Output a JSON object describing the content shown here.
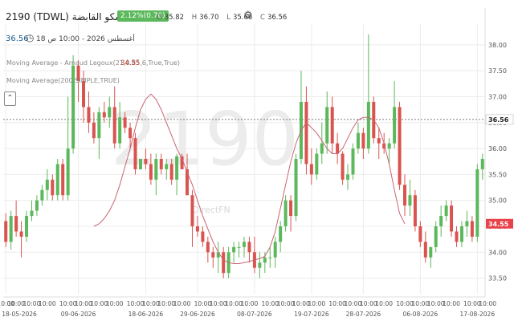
{
  "header": {
    "title": "2190  (TDWL)  سيسكو القابضة",
    "change_badge": "2.12%(0.76)",
    "ohlc": [
      {
        "label": "O",
        "value": "35.82"
      },
      {
        "label": "H",
        "value": "36.70"
      },
      {
        "label": "L",
        "value": "35.66"
      },
      {
        "label": "C",
        "value": "36.56"
      }
    ],
    "last_price": "36.56",
    "timestamp": "18 أغسطس 2026 - 10:00 ص",
    "icons": {
      "settings": "gear-icon",
      "clock": "clock-icon",
      "collapse": "chevron-up-icon"
    }
  },
  "indicators": [
    {
      "label": "Moving Average - Arnaud Legoux(21,0.85,6,True,True)",
      "value": "34.55"
    },
    {
      "label": "Moving Average(200,SIMPLE,TRUE)",
      "value": ""
    }
  ],
  "watermark": {
    "symbol": "2190",
    "brand": "DirectFN"
  },
  "colors": {
    "up": "#5cb85c",
    "down": "#d9534f",
    "ma": "#c86472",
    "grid": "#ececec",
    "last_price_label": "#222222",
    "ma_label": "#e8424a"
  },
  "chart_data": {
    "type": "candlestick",
    "ylim": [
      33.2,
      38.4
    ],
    "yticks": [
      33.5,
      34.0,
      34.5,
      35.0,
      35.5,
      36.0,
      36.5,
      37.0,
      37.5,
      38.0
    ],
    "ytick_labels": [
      "33.50",
      "34.00",
      "34.50",
      "35.00",
      "35.50",
      "36.00",
      "36.50",
      "37.00",
      "37.50",
      "38.00"
    ],
    "price_labels": [
      {
        "value": 36.56,
        "label": "36.56",
        "style": "last"
      },
      {
        "value": 34.55,
        "label": "34.55",
        "style": "ma"
      }
    ],
    "xtick_labels": [
      {
        "index": 0,
        "label": "10:00"
      },
      {
        "index": 2,
        "label": "10:00"
      },
      {
        "index": 5,
        "label": "10:00"
      },
      {
        "index": 8,
        "label": "10:00"
      },
      {
        "index": 12,
        "label": "10:00"
      },
      {
        "index": 15,
        "label": "10:00"
      },
      {
        "index": 18,
        "label": "10:00"
      },
      {
        "index": 21,
        "label": "10:00"
      },
      {
        "index": 25,
        "label": "10:00"
      },
      {
        "index": 28,
        "label": "10:00"
      },
      {
        "index": 31,
        "label": "10:00"
      },
      {
        "index": 34,
        "label": "10:00"
      },
      {
        "index": 38,
        "label": "10:00"
      },
      {
        "index": 41,
        "label": "10:00"
      },
      {
        "index": 44,
        "label": "10:00"
      },
      {
        "index": 47,
        "label": "10:00"
      },
      {
        "index": 51,
        "label": "10:00"
      },
      {
        "index": 54,
        "label": "10:00"
      },
      {
        "index": 57,
        "label": "10:00"
      },
      {
        "index": 60,
        "label": "10:00"
      },
      {
        "index": 64,
        "label": "10:00"
      },
      {
        "index": 67,
        "label": "10:00"
      },
      {
        "index": 70,
        "label": "10:00"
      },
      {
        "index": 73,
        "label": "10:00"
      },
      {
        "index": 77,
        "label": "10:00"
      },
      {
        "index": 80,
        "label": "10:00"
      },
      {
        "index": 83,
        "label": "10:00"
      },
      {
        "index": 86,
        "label": "10:00"
      },
      {
        "index": 90,
        "label": "10:00"
      },
      {
        "index": 93,
        "label": "10:00"
      }
    ],
    "date_labels": [
      {
        "index": 0,
        "label": "18-05-2026"
      },
      {
        "index": 14,
        "label": "09-06-2026"
      },
      {
        "index": 27,
        "label": "18-06-2026"
      },
      {
        "index": 37,
        "label": "29-06-2026"
      },
      {
        "index": 48,
        "label": "08-07-2026"
      },
      {
        "index": 59,
        "label": "19-07-2026"
      },
      {
        "index": 69,
        "label": "28-07-2026"
      },
      {
        "index": 80,
        "label": "06-08-2026"
      },
      {
        "index": 91,
        "label": "17-08-2026"
      }
    ],
    "candles": [
      [
        34.6,
        34.75,
        34.1,
        34.2
      ],
      [
        34.2,
        34.8,
        34.05,
        34.7
      ],
      [
        34.7,
        35.0,
        34.3,
        34.4
      ],
      [
        34.4,
        34.6,
        33.9,
        34.3
      ],
      [
        34.3,
        34.8,
        34.2,
        34.7
      ],
      [
        34.7,
        35.0,
        34.6,
        34.8
      ],
      [
        34.8,
        35.1,
        34.7,
        35.0
      ],
      [
        35.0,
        35.3,
        34.9,
        35.2
      ],
      [
        35.2,
        35.6,
        35.0,
        35.4
      ],
      [
        35.4,
        35.5,
        35.0,
        35.1
      ],
      [
        35.1,
        35.8,
        35.0,
        35.7
      ],
      [
        35.7,
        35.8,
        35.0,
        35.1
      ],
      [
        35.1,
        37.0,
        35.0,
        36.0
      ],
      [
        36.0,
        37.8,
        35.9,
        37.6
      ],
      [
        37.6,
        37.7,
        36.9,
        37.3
      ],
      [
        37.3,
        37.5,
        36.5,
        36.8
      ],
      [
        36.8,
        37.1,
        36.3,
        36.5
      ],
      [
        36.5,
        36.7,
        36.1,
        36.2
      ],
      [
        36.2,
        36.8,
        35.8,
        36.7
      ],
      [
        36.7,
        36.9,
        36.5,
        36.6
      ],
      [
        36.6,
        37.0,
        36.4,
        36.8
      ],
      [
        36.8,
        37.2,
        36.0,
        36.1
      ],
      [
        36.1,
        36.9,
        36.0,
        36.6
      ],
      [
        36.6,
        36.7,
        36.3,
        36.4
      ],
      [
        36.4,
        36.5,
        36.0,
        36.2
      ],
      [
        36.2,
        36.3,
        35.5,
        35.6
      ],
      [
        35.6,
        35.8,
        35.6,
        35.8
      ],
      [
        35.8,
        36.0,
        35.6,
        35.7
      ],
      [
        35.7,
        35.9,
        35.3,
        35.4
      ],
      [
        35.4,
        35.9,
        35.1,
        35.8
      ],
      [
        35.8,
        35.9,
        35.5,
        35.6
      ],
      [
        35.6,
        35.8,
        35.4,
        35.7
      ],
      [
        35.7,
        35.8,
        35.3,
        35.4
      ],
      [
        35.4,
        35.9,
        35.1,
        35.85
      ],
      [
        35.85,
        35.9,
        35.6,
        35.6
      ],
      [
        35.6,
        35.9,
        35.1,
        35.1
      ],
      [
        35.1,
        35.2,
        34.1,
        34.5
      ],
      [
        34.5,
        34.7,
        34.3,
        34.4
      ],
      [
        34.4,
        34.5,
        34.1,
        34.2
      ],
      [
        34.2,
        34.3,
        33.8,
        34.0
      ],
      [
        34.0,
        34.1,
        33.7,
        33.9
      ],
      [
        33.9,
        34.2,
        33.6,
        34.0
      ],
      [
        34.0,
        34.1,
        33.5,
        33.6
      ],
      [
        33.6,
        34.1,
        33.5,
        34.0
      ],
      [
        34.0,
        34.2,
        33.8,
        34.1
      ],
      [
        34.1,
        34.2,
        33.9,
        34.1
      ],
      [
        34.1,
        34.3,
        33.9,
        34.2
      ],
      [
        34.2,
        34.3,
        33.8,
        34.0
      ],
      [
        34.0,
        34.3,
        33.6,
        33.7
      ],
      [
        33.7,
        34.0,
        33.5,
        33.8
      ],
      [
        33.8,
        34.0,
        33.6,
        33.9
      ],
      [
        33.9,
        34.1,
        33.7,
        33.9
      ],
      [
        33.9,
        34.3,
        33.7,
        34.2
      ],
      [
        34.2,
        34.6,
        34.0,
        34.5
      ],
      [
        34.5,
        35.1,
        34.4,
        35.0
      ],
      [
        35.0,
        35.1,
        34.4,
        34.7
      ],
      [
        34.7,
        35.9,
        34.6,
        35.8
      ],
      [
        35.8,
        37.5,
        35.7,
        36.9
      ],
      [
        36.9,
        37.2,
        35.5,
        35.7
      ],
      [
        35.7,
        36.0,
        35.3,
        35.5
      ],
      [
        35.5,
        36.0,
        35.4,
        35.9
      ],
      [
        35.9,
        36.5,
        35.7,
        36.1
      ],
      [
        36.1,
        37.1,
        35.9,
        36.8
      ],
      [
        36.8,
        37.0,
        35.9,
        36.1
      ],
      [
        36.1,
        36.3,
        35.7,
        35.9
      ],
      [
        35.9,
        35.95,
        35.3,
        35.4
      ],
      [
        35.4,
        35.7,
        35.2,
        35.5
      ],
      [
        35.5,
        36.1,
        35.4,
        36.0
      ],
      [
        36.0,
        36.5,
        35.9,
        36.3
      ],
      [
        36.3,
        36.4,
        35.8,
        36.0
      ],
      [
        36.0,
        38.2,
        35.9,
        36.9
      ],
      [
        36.9,
        37.0,
        36.1,
        36.2
      ],
      [
        36.2,
        36.4,
        35.8,
        36.1
      ],
      [
        36.1,
        36.3,
        35.9,
        36.0
      ],
      [
        36.0,
        36.2,
        35.7,
        36.1
      ],
      [
        36.1,
        37.3,
        36.0,
        36.8
      ],
      [
        36.8,
        36.9,
        35.2,
        35.3
      ],
      [
        35.3,
        35.5,
        34.7,
        34.9
      ],
      [
        34.9,
        35.4,
        34.7,
        35.1
      ],
      [
        35.1,
        35.2,
        34.4,
        34.5
      ],
      [
        34.5,
        34.6,
        34.1,
        34.2
      ],
      [
        34.2,
        34.4,
        33.8,
        33.9
      ],
      [
        33.9,
        34.1,
        33.7,
        34.1
      ],
      [
        34.1,
        34.6,
        34.0,
        34.5
      ],
      [
        34.5,
        34.9,
        34.3,
        34.7
      ],
      [
        34.7,
        35.0,
        34.6,
        34.9
      ],
      [
        34.9,
        35.0,
        34.3,
        34.4
      ],
      [
        34.4,
        34.5,
        34.1,
        34.2
      ],
      [
        34.2,
        34.6,
        34.1,
        34.5
      ],
      [
        34.5,
        34.8,
        34.3,
        34.6
      ],
      [
        34.6,
        34.7,
        34.2,
        34.3
      ],
      [
        34.3,
        35.7,
        34.2,
        35.6
      ],
      [
        35.6,
        35.9,
        35.4,
        35.8
      ]
    ],
    "series": [
      {
        "name": "Moving Average - Arnaud Legoux(21,0.85,6,True,True)",
        "start_index": 17,
        "values": [
          34.5,
          34.55,
          34.65,
          34.8,
          35.0,
          35.3,
          35.65,
          36.0,
          36.4,
          36.75,
          36.95,
          37.05,
          36.95,
          36.75,
          36.5,
          36.25,
          36.0,
          35.8,
          35.55,
          35.3,
          35.0,
          34.7,
          34.45,
          34.2,
          34.0,
          33.85,
          33.8,
          33.78,
          33.78,
          33.8,
          33.82,
          33.85,
          33.88,
          33.92,
          34.1,
          34.4,
          34.85,
          35.3,
          35.75,
          36.1,
          36.35,
          36.5,
          36.4,
          36.3,
          36.15,
          36.0,
          35.9,
          35.9,
          36.0,
          36.2,
          36.4,
          36.55,
          36.6,
          36.6,
          36.55,
          36.4,
          36.1,
          35.7,
          35.2,
          34.75,
          34.55
        ]
      }
    ]
  }
}
